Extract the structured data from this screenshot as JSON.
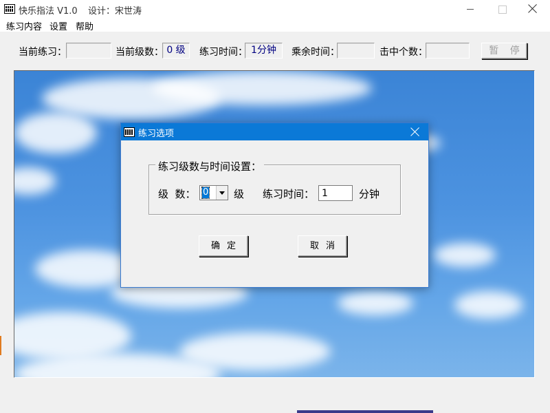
{
  "window": {
    "title": "快乐指法 V1.0",
    "designer": "设计：宋世涛",
    "close_symbol": "×"
  },
  "menu": {
    "items": [
      "练习内容",
      "设置",
      "帮助"
    ]
  },
  "status_bar": {
    "current_practice_label": "当前练习：",
    "current_practice_value": "",
    "current_level_label": "当前级数：",
    "current_level_value": "0 级",
    "practice_time_label": "练习时间：",
    "practice_time_value": "1分钟",
    "remaining_time_label": "乘余时间：",
    "remaining_time_value": "",
    "hit_count_label": "击中个数：",
    "hit_count_value": "",
    "pause_button": "暂 停"
  },
  "dialog": {
    "title": "练习选项",
    "group_title": "练习级数与时间设置：",
    "level_label": "级  数：",
    "level_value": "0",
    "level_unit": "级",
    "time_label": "练习时间：",
    "time_value": "1",
    "time_unit": "分钟",
    "ok_button": "确定",
    "cancel_button": "取消"
  },
  "colors": {
    "dialog_title_bar": "#0b79d7",
    "field_text": "#000080",
    "selection": "#0078d7"
  }
}
